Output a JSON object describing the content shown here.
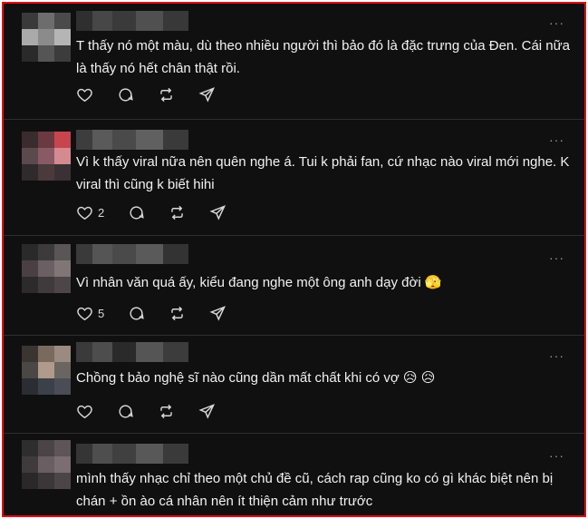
{
  "more_glyph": "···",
  "comments": [
    {
      "text": "T thấy nó một màu, dù theo nhiều người thì bảo đó là đặc trưng của Đen. Cái nữa là thấy nó hết chân thật rồi.",
      "likes": "",
      "avatar_colors": [
        "#3a3a3a",
        "#6d6d6d",
        "#4a4a4a",
        "#aaaaaa",
        "#8b8b8b",
        "#b5b5b5",
        "#2a2a2a",
        "#555555",
        "#3c3c3c"
      ],
      "name_colors": [
        "#2f2f2f",
        "#474747",
        "#3a3a3a",
        "#505050",
        "#383838"
      ]
    },
    {
      "text": "Vì k thấy viral nữa nên quên nghe á. Tui k phải fan, cứ nhạc nào viral mới nghe. K viral thì cũng k biết hihi",
      "likes": "2",
      "avatar_colors": [
        "#3a2b2e",
        "#6b3940",
        "#c8454e",
        "#5a4a4e",
        "#8a5a64",
        "#d48a8f",
        "#2f2a2c",
        "#4a3a3d",
        "#3b3134"
      ],
      "name_colors": [
        "#3d3d3d",
        "#5a5a5a",
        "#4a4a4a",
        "#606060",
        "#3a3a3a"
      ]
    },
    {
      "text": "Vì nhân văn quá ấy, kiểu đang nghe một ông anh dạy đời 🫣",
      "likes": "5",
      "avatar_colors": [
        "#2a2a2a",
        "#3d3a3b",
        "#5a5556",
        "#4a3f42",
        "#6a5f62",
        "#807577",
        "#2c2a2b",
        "#3f3b3c",
        "#4d4648"
      ],
      "name_colors": [
        "#3a3a3a",
        "#555555",
        "#4a4a4a",
        "#5a5a5a",
        "#333333"
      ]
    },
    {
      "text": "Chồng t bảo nghệ sĩ nào cũng dần mất chất khi có vợ 😥 😥",
      "likes": "",
      "avatar_colors": [
        "#3a3530",
        "#7a6a5e",
        "#9a8a80",
        "#4a4744",
        "#b09a8a",
        "#6a6560",
        "#2a2d33",
        "#3c4048",
        "#4a4d55"
      ],
      "name_colors": [
        "#3a3a3a",
        "#4d4d4d",
        "#2a2a2a",
        "#555555",
        "#3c3c3c"
      ]
    },
    {
      "text": "mình thấy nhạc chỉ theo một chủ đề cũ, cách rap cũng ko có gì khác biệt nên bị chán + ồn ào cá nhân nên ít thiện cảm như trước",
      "likes": "",
      "avatar_colors": [
        "#2e2e2e",
        "#4a4446",
        "#5d5558",
        "#3f3a3c",
        "#6a5e62",
        "#7a6e72",
        "#2a2829",
        "#3b3637",
        "#4c4547"
      ],
      "name_colors": [
        "#353535",
        "#4e4e4e",
        "#404040",
        "#585858",
        "#3a3a3a"
      ]
    }
  ]
}
